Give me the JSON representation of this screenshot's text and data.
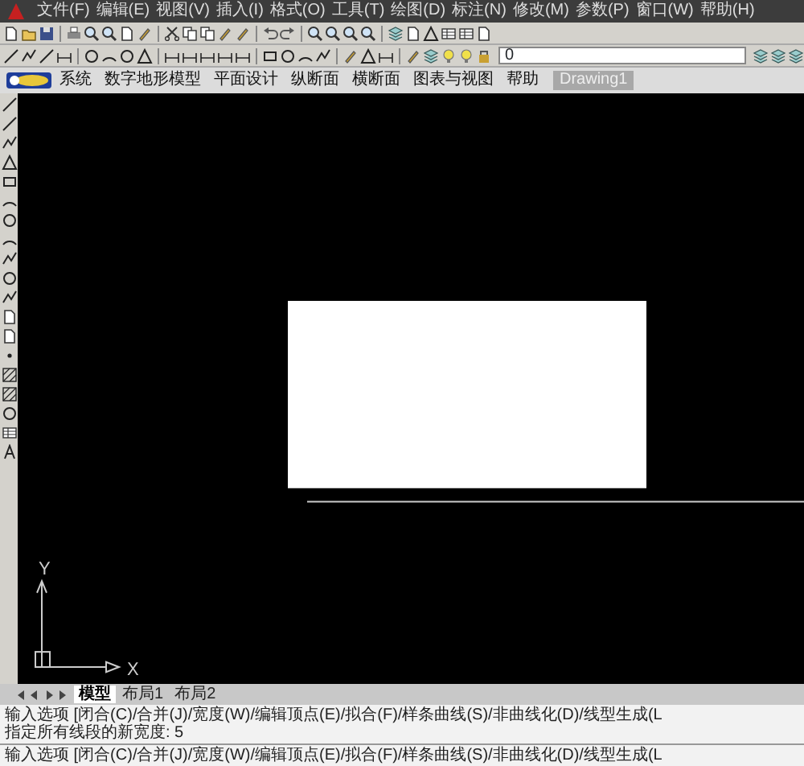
{
  "menu": [
    "文件(F)",
    "编辑(E)",
    "视图(V)",
    "插入(I)",
    "格式(O)",
    "工具(T)",
    "绘图(D)",
    "标注(N)",
    "修改(M)",
    "参数(P)",
    "窗口(W)",
    "帮助(H)"
  ],
  "layer_combo": {
    "value": "0"
  },
  "app_menu": [
    "系统",
    "数字地形模型",
    "平面设计",
    "纵断面",
    "横断面",
    "图表与视图",
    "帮助"
  ],
  "document_tab": "Drawing1",
  "ucs": {
    "y_label": "Y",
    "x_label": "X"
  },
  "layout_tabs": [
    {
      "label": "模型",
      "selected": true
    },
    {
      "label": "布局1",
      "selected": false
    },
    {
      "label": "布局2",
      "selected": false
    }
  ],
  "command_history": [
    "输入选项 [闭合(C)/合并(J)/宽度(W)/编辑顶点(E)/拟合(F)/样条曲线(S)/非曲线化(D)/线型生成(L",
    "指定所有线段的新宽度: 5"
  ],
  "command_prompt": "输入选项 [闭合(C)/合并(J)/宽度(W)/编辑顶点(E)/拟合(F)/样条曲线(S)/非曲线化(D)/线型生成(L"
}
